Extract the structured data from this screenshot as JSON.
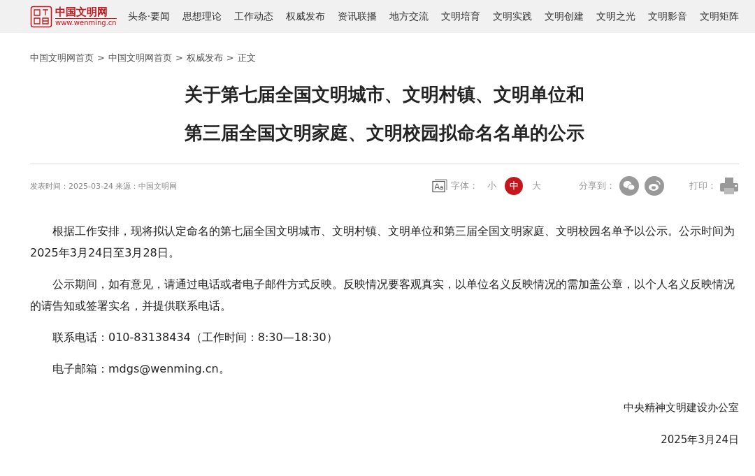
{
  "header": {
    "logo": {
      "name": "中国文明网",
      "url": "www.wenming.cn"
    },
    "nav": [
      {
        "label": "头条·要闻"
      },
      {
        "label": "思想理论"
      },
      {
        "label": "工作动态"
      },
      {
        "label": "权威发布"
      },
      {
        "label": "资讯联播"
      },
      {
        "label": "地方交流"
      },
      {
        "label": "文明培育"
      },
      {
        "label": "文明实践"
      },
      {
        "label": "文明创建"
      },
      {
        "label": "文明之光"
      },
      {
        "label": "文明影音"
      },
      {
        "label": "文明矩阵"
      }
    ]
  },
  "breadcrumb": [
    {
      "label": "中国文明网首页"
    },
    {
      "label": "中国文明网首页"
    },
    {
      "label": "权威发布"
    },
    {
      "label": "正文"
    }
  ],
  "breadcrumb_separator": ">",
  "title_lines": [
    "关于第七届全国文明城市、文明村镇、文明单位和",
    "第三届全国文明家庭、文明校园拟命名名单的公示"
  ],
  "meta": {
    "info": "发表时间：2025-03-24 来源：中国文明网",
    "font_label": "字体：",
    "font_sizes": [
      {
        "label": "小",
        "selected": false
      },
      {
        "label": "中",
        "selected": true
      },
      {
        "label": "大",
        "selected": false
      }
    ],
    "share_label": "分享到：",
    "print_label": "打印："
  },
  "paragraphs": [
    "根据工作安排，现将拟认定命名的第七届全国文明城市、文明村镇、文明单位和第三届全国文明家庭、文明校园名单予以公示。公示时间为2025年3月24日至3月28日。",
    "公示期间，如有意见，请通过电话或者电子邮件方式反映。反映情况要客观真实，以单位名义反映情况的需加盖公章，以个人名义反映情况的请告知或签署实名，并提供联系电话。",
    "联系电话：010-83138434（工作时间：8:30—18:30）",
    "电子邮箱：mdgs@wenming.cn。"
  ],
  "signature": "中央精神文明建设办公室",
  "date": "2025年3月24日"
}
